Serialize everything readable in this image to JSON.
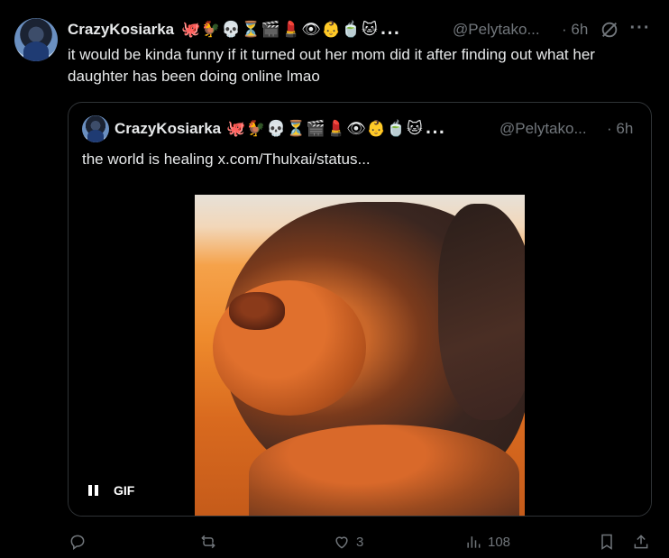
{
  "tweet": {
    "display_name": "CrazyKosiarka",
    "name_emojis": "🐙🐓💀⏳🎬💄👁👶🍵🐱",
    "name_truncation": "...",
    "handle": "@Pelytako...",
    "time": "6h",
    "text": "it would be kinda funny if it turned out her mom did it after finding out what her daughter has been doing online lmao"
  },
  "quote": {
    "display_name": "CrazyKosiarka",
    "name_emojis": "🐙🐓💀⏳🎬💄👁👶🍵🐱",
    "name_truncation": "...",
    "handle": "@Pelytako...",
    "time": "6h",
    "text": "the world is healing",
    "link": "x.com/Thulxai/status...",
    "media": {
      "gif_label": "GIF"
    }
  },
  "actions": {
    "reply_count": "",
    "repost_count": "",
    "like_count": "3",
    "view_count": "108"
  },
  "icons": {
    "reply": "reply-icon",
    "repost": "repost-icon",
    "like": "heart-icon",
    "views": "views-icon",
    "bookmark": "bookmark-icon",
    "share": "share-icon",
    "grok": "grok-icon",
    "more": "more-icon"
  },
  "colors": {
    "background": "#000000",
    "text": "#e7e9ea",
    "muted": "#71767b",
    "border": "#2f3336"
  }
}
